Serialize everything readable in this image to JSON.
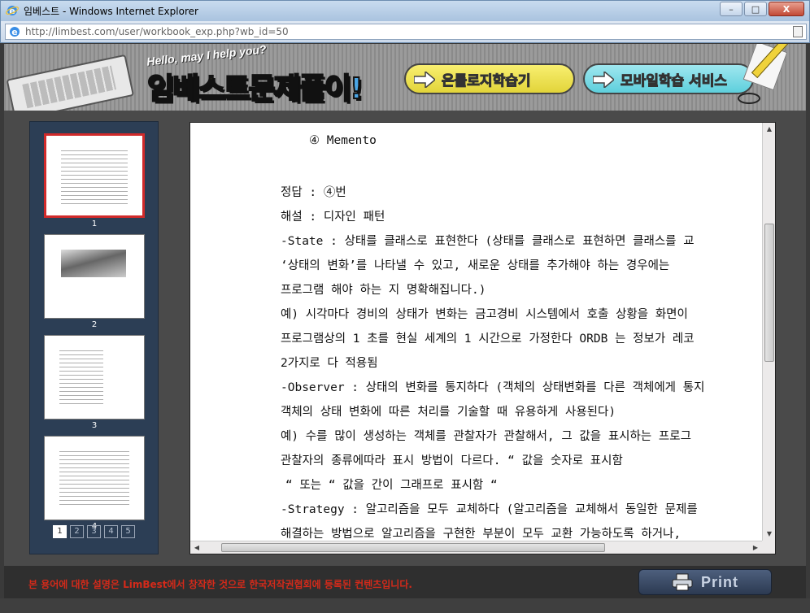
{
  "window": {
    "title": "임베스트 - Windows Internet Explorer",
    "url": "http://limbest.com/user/workbook_exp.php?wb_id=50",
    "buttons": {
      "minimize": "–",
      "maximize": "□",
      "close": "X"
    }
  },
  "banner": {
    "greeting": "Hello, may I help you?",
    "logo_part1": "임베스트",
    "logo_part2": "문제풀이!",
    "ontology_button_prefix": "온톨로지",
    "ontology_button_suffix": " 학습기",
    "mobile_button_prefix": "모바일",
    "mobile_button_suffix": " 학습 서비스",
    "colors": {
      "ontology": "#f0e04a",
      "mobile": "#72d8e4"
    }
  },
  "thumbnails": {
    "pages": [
      {
        "label": "1",
        "active": true
      },
      {
        "label": "2",
        "active": false
      },
      {
        "label": "3",
        "active": false
      },
      {
        "label": "4",
        "active": false
      }
    ],
    "pager": [
      "1",
      "2",
      "3",
      "4",
      "5"
    ],
    "current_page": "1"
  },
  "document": {
    "lines": [
      "④  Memento",
      "정답 : ④번",
      "해설 : 디자인 패턴",
      "-State : 상태를 클래스로 표현한다 (상태를 클래스로 표현하면 클래스를 교",
      "‘상태의 변화’를 나타낼 수 있고, 새로운 상태를 추가해야 하는 경우에는",
      "프로그램 해야 하는 지 명확해집니다.)",
      "예) 시각마다 경비의 상태가 변화는 금고경비 시스템에서 호출 상황을 화면이",
      "프로그램상의 1 초를 현실 세계의 1 시간으로 가정한다 ORDB 는 정보가 레코",
      "2가지로 다 적용됨",
      "-Observer : 상태의 변화를 통지하다 (객체의 상태변화를 다른 객체에게 통지",
      "객체의 상태 변화에 따른 처리를 기술할 때 유용하게 사용된다)",
      "예) 수를 많이 생성하는 객체를 관찰자가 관찰해서, 그 값을 표시하는 프로그",
      "관찰자의 종류에따라 표시 방법이 다르다. “ 값을 숫자로 표시함",
      "“ 또는 “ 값을 간이 그래프로 표시함 “",
      "-Strategy : 알고리즘을 모두 교체하다 (알고리즘을 교체해서 동일한 문제를",
      "해결하는 방법으로 알고리즘을 구현한 부분이 모두 교환 가능하도록 하거나,"
    ]
  },
  "footer": {
    "notice": "본 용어에 대한 설명은 LimBest에서 창작한 것으로 한국저작권협회에 등록된 컨텐츠입니다.",
    "print_label": "Print"
  }
}
